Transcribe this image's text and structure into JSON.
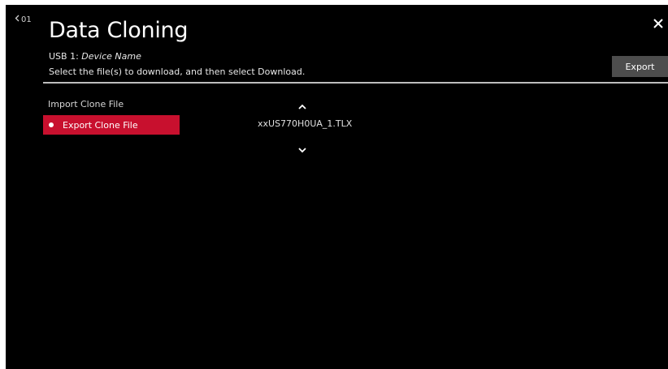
{
  "screen": {
    "back_label": "01",
    "title": "Data Cloning",
    "close_icon": "close-icon"
  },
  "device": {
    "prefix": "USB 1: ",
    "name": "Device Name"
  },
  "instruction": "Select the file(s) to download, and then select Download.",
  "toolbar": {
    "export_label": "Export"
  },
  "menu": {
    "items": [
      {
        "label": "Import Clone File",
        "selected": false
      },
      {
        "label": "Export Clone File",
        "selected": true
      }
    ]
  },
  "files": {
    "list": [
      "xxUS770H0UA_1.TLX"
    ],
    "scroll_up_icon": "chevron-up-icon",
    "scroll_down_icon": "chevron-down-icon"
  },
  "colors": {
    "background": "#000000",
    "accent": "#c8102e",
    "button_bg": "#4d4d4d"
  }
}
